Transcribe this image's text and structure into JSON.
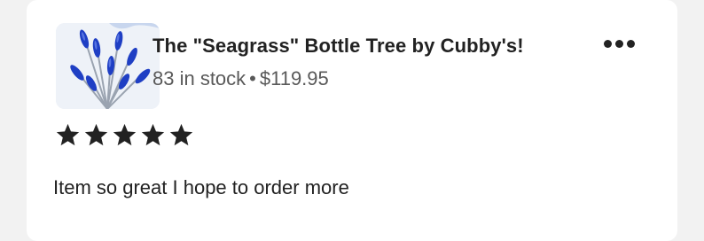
{
  "product": {
    "title": "The \"Seagrass\" Bottle Tree by Cubby's!",
    "stock": "83 in stock",
    "separator": "•",
    "price": "$119.95",
    "thumbnail_icon": "bottle-tree-product-image"
  },
  "menu": {
    "icon": "more-options-icon"
  },
  "review": {
    "rating": 5,
    "rating_max": 5,
    "star_color": "#222222",
    "text": "Item so great I hope to order more"
  }
}
